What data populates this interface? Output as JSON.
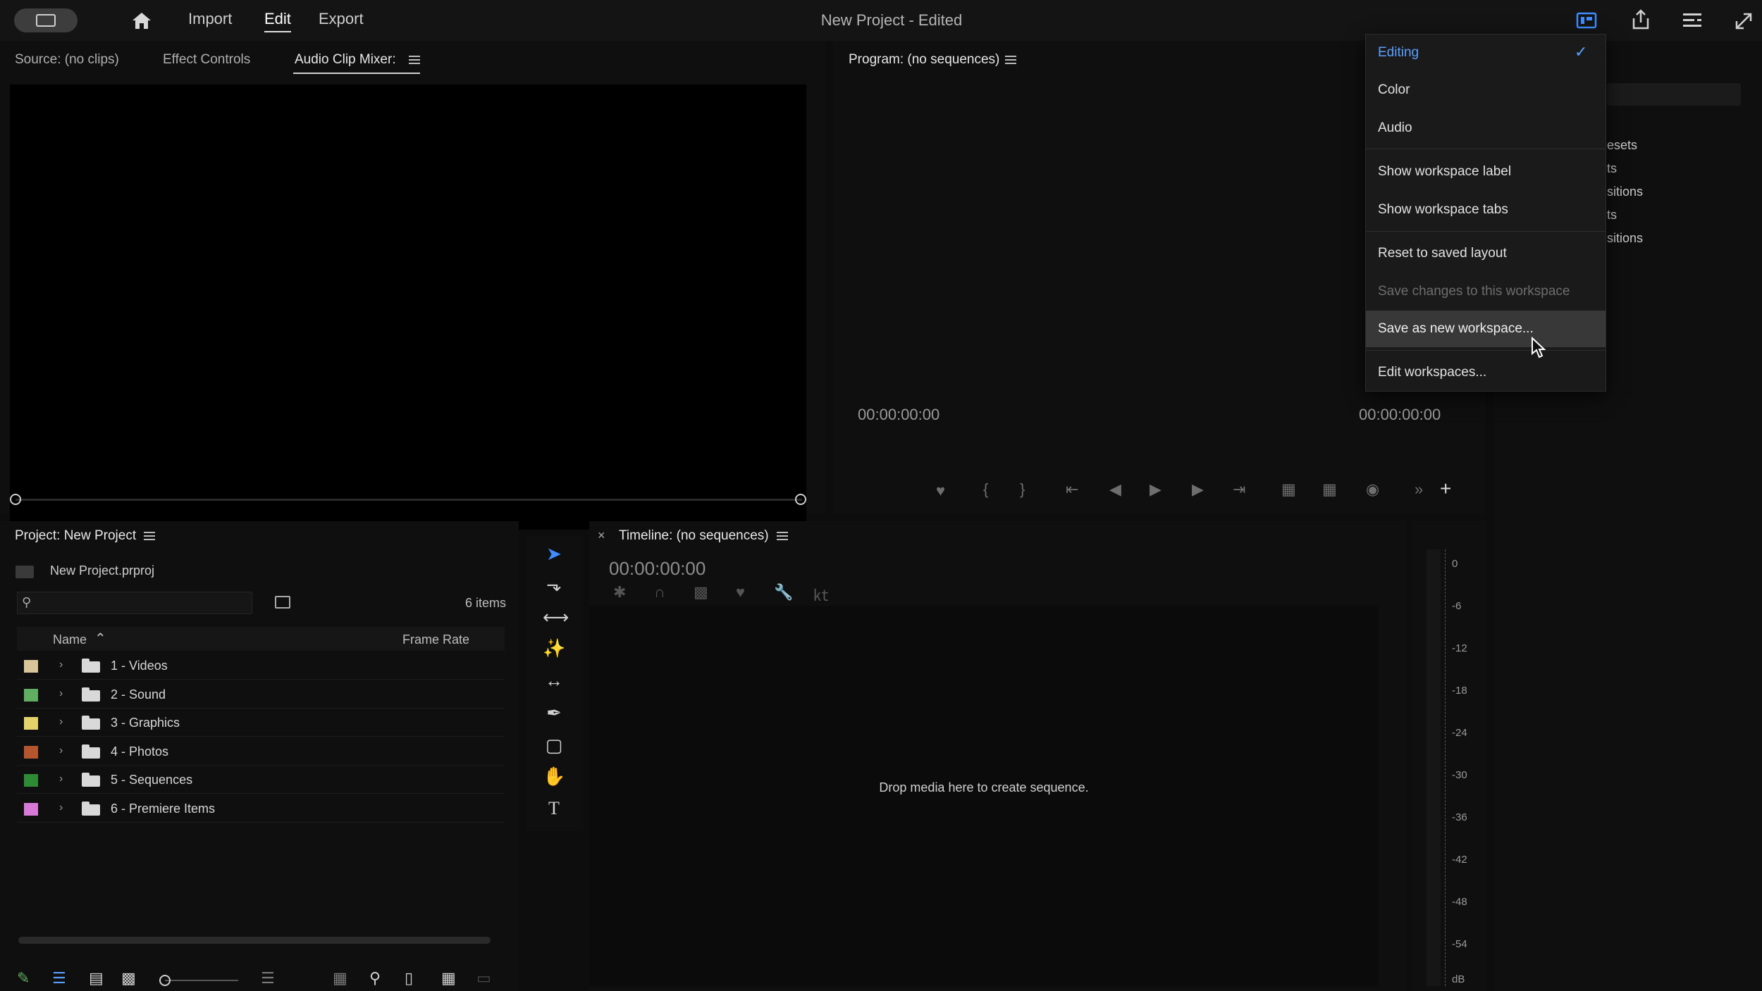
{
  "topbar": {
    "nav": [
      "Import",
      "Edit",
      "Export"
    ],
    "window_title": "New Project - Edited"
  },
  "source_panel": {
    "tabs": [
      "Source: (no clips)",
      "Effect Controls",
      "Audio Clip Mixer:"
    ]
  },
  "program_panel": {
    "title": "Program: (no sequences)",
    "timecode_left": "00:00:00:00",
    "timecode_right": "00:00:00:00"
  },
  "workspace_menu": {
    "items": [
      {
        "label": "Editing",
        "state": "checked"
      },
      {
        "label": "Color",
        "state": "normal"
      },
      {
        "label": "Audio",
        "state": "normal"
      },
      {
        "label": "Show workspace label",
        "state": "normal"
      },
      {
        "label": "Show workspace tabs",
        "state": "normal"
      },
      {
        "label": "Reset to saved layout",
        "state": "normal"
      },
      {
        "label": "Save changes to this workspace",
        "state": "disabled"
      },
      {
        "label": "Save as new workspace...",
        "state": "hover"
      },
      {
        "label": "Edit workspaces...",
        "state": "normal"
      }
    ]
  },
  "effects_panel_partial": [
    "esets",
    "ts",
    "sitions",
    "ts",
    "sitions"
  ],
  "project_panel": {
    "title": "Project: New Project",
    "file": "New Project.prproj",
    "item_count": "6 items",
    "search_placeholder": "",
    "columns": {
      "name": "Name",
      "frame_rate": "Frame Rate"
    },
    "items": [
      {
        "label": "1 - Videos",
        "color": "#d8c59a"
      },
      {
        "label": "2 - Sound",
        "color": "#5fae62"
      },
      {
        "label": "3 - Graphics",
        "color": "#e4d36a"
      },
      {
        "label": "4 - Photos",
        "color": "#b5552f"
      },
      {
        "label": "5 - Sequences",
        "color": "#2f8a36"
      },
      {
        "label": "6 - Premiere Items",
        "color": "#d77ad7"
      }
    ]
  },
  "timeline_panel": {
    "title": "Timeline: (no sequences)",
    "timecode": "00:00:00:00",
    "drop_hint": "Drop media here to create sequence."
  },
  "audio_meter": {
    "ticks": [
      "0",
      "-6",
      "-12",
      "-18",
      "-24",
      "-30",
      "-36",
      "-42",
      "-48",
      "-54",
      "dB"
    ]
  },
  "colors": {
    "accent": "#5aa0ff",
    "menu_bg": "#1a1a1a",
    "hover_bg": "#383838"
  }
}
